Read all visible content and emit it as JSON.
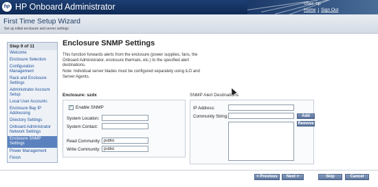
{
  "header": {
    "logo_text": "hp",
    "app_title": "HP Onboard Administrator",
    "user_label": "User: hp",
    "home_link": "Home",
    "separator": "|",
    "signout_link": "Sign Out"
  },
  "wizard": {
    "title": "First Time Setup Wizard",
    "subtitle": "Set up initial enclosure and server settings"
  },
  "steps": {
    "heading": "Step 9 of 11",
    "items": [
      {
        "label": "Welcome"
      },
      {
        "label": "Enclosure Selection"
      },
      {
        "label": "Configuration"
      },
      {
        "label": "Management"
      },
      {
        "label": "Rack and Enclosure"
      },
      {
        "label": "Settings"
      },
      {
        "label": "Administrator Account"
      },
      {
        "label": "Setup"
      },
      {
        "label": "Local User Accounts"
      },
      {
        "label": "Enclosure Bay IP"
      },
      {
        "label": "Addressing"
      },
      {
        "label": "Directory Settings"
      },
      {
        "label": "Onboard Administrator"
      },
      {
        "label": "Network Settings"
      },
      {
        "label": "Enclosure SNMP"
      },
      {
        "label": "Settings"
      },
      {
        "label": "Power Management"
      },
      {
        "label": "Finish"
      }
    ]
  },
  "main": {
    "title": "Enclosure SNMP Settings",
    "desc_lines": [
      "This function forwards alerts from the enclosure (power supplies, fans, the",
      "Onboard Administrator, enclosure thermals, etc.) to the specified alert",
      "destinations."
    ],
    "note_lines": [
      "Note: Individual server blades must be configured separately using iLO and",
      "Server Agents."
    ],
    "enclosure_label": "Enclosure: szdx",
    "enable_snmp_label": "Enable SNMP",
    "enable_snmp_checked": "✓",
    "system_location_label": "System Location:",
    "system_location_value": "",
    "system_contact_label": "System Contact:",
    "system_contact_value": "",
    "read_community_label": "Read Community:",
    "read_community_value": "public",
    "write_community_label": "Write Community:",
    "write_community_value": "public",
    "alert_dest_title": "SNMP Alert Destinations",
    "ip_address_label": "IP Address:",
    "ip_address_value": "",
    "community_string_label": "Community String:",
    "community_string_value": "",
    "add_button": "Add",
    "remove_button": "Remove"
  },
  "footer": {
    "previous_button": "< Previous",
    "next_button": "Next >",
    "skip_button": "Skip",
    "cancel_button": "Cancel"
  },
  "colors": {
    "banner": "#1d3f73",
    "active_step": "#5b82bf",
    "link": "#1d4f9a",
    "button": "#5e779f"
  }
}
